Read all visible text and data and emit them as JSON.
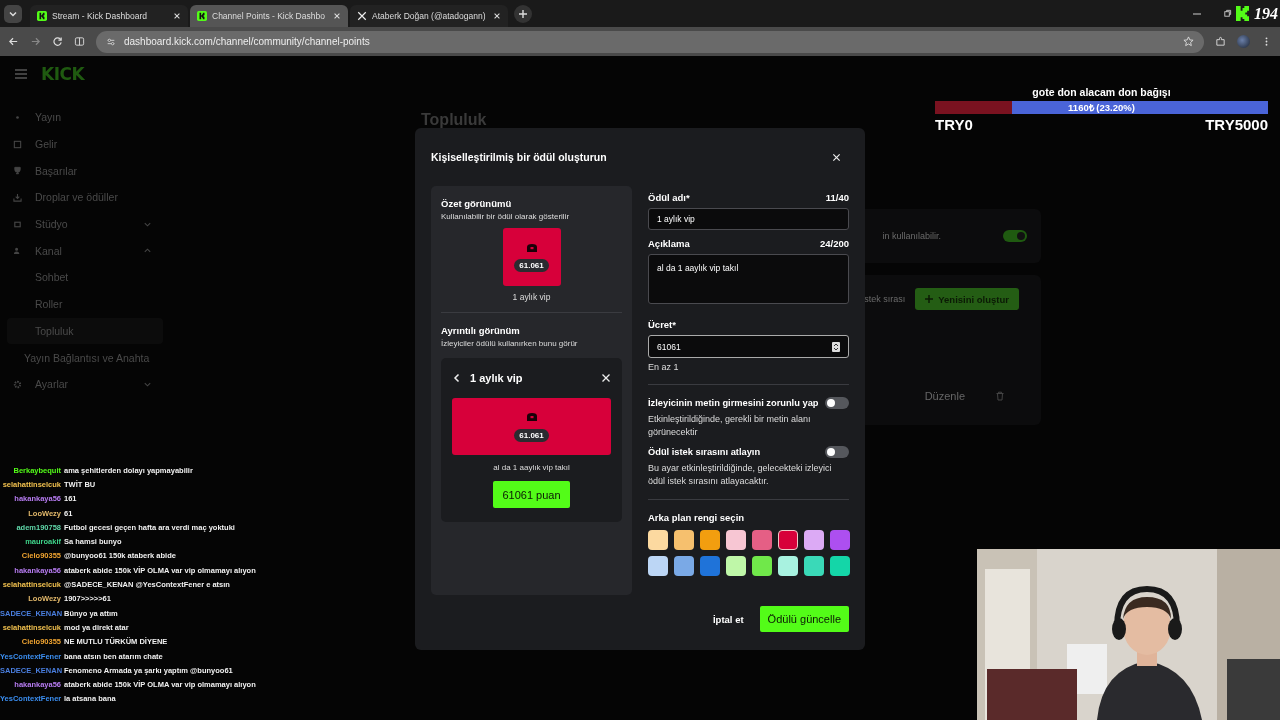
{
  "browser": {
    "tabs": [
      {
        "title": "Stream - Kick Dashboard",
        "selected": false,
        "kind": "kick"
      },
      {
        "title": "Channel Points - Kick Dashbo",
        "selected": true,
        "kind": "kick"
      },
      {
        "title": "Ataberk Doğan (@atadogann)",
        "selected": false,
        "kind": "x"
      }
    ],
    "url": "dashboard.kick.com/channel/community/channel-points",
    "viewer_count": "194"
  },
  "sidebar": {
    "logo": "KICK",
    "items": [
      {
        "label": "Yayın",
        "selected": false
      },
      {
        "label": "Gelir",
        "selected": false
      },
      {
        "label": "Başarılar",
        "selected": false
      },
      {
        "label": "Droplar ve ödüller",
        "selected": false
      },
      {
        "label": "Stüdyo",
        "selected": false,
        "expanded": false
      },
      {
        "label": "Kanal",
        "selected": false,
        "expanded": true,
        "children": [
          {
            "label": "Sohbet",
            "selected": false
          },
          {
            "label": "Roller",
            "selected": false
          },
          {
            "label": "Topluluk",
            "selected": true
          }
        ]
      },
      {
        "label": "Yayın Bağlantısı ve Anahta",
        "selected": false,
        "kind": "plain"
      },
      {
        "label": "Ayarlar",
        "selected": false,
        "expanded": false
      }
    ]
  },
  "page": {
    "heading": "Topluluk",
    "setting_text": "in kullanılabilir.",
    "setting_on": true,
    "queue_text": "stek sırası",
    "new_button": "Yenisini oluştur",
    "edit_link": "Düzenle"
  },
  "modal": {
    "title": "Kişiselleştirilmiş bir ödül oluşturun",
    "summary": {
      "title": "Özet görünümü",
      "subtitle": "Kullanılabilir bir ödül olarak gösterilir",
      "badge": "61.061",
      "name": "1 aylık vip"
    },
    "detail": {
      "title": "Ayrıntılı görünüm",
      "subtitle": "İzleyiciler ödülü kullanırken bunu görür",
      "header": "1 aylık vip",
      "badge": "61.061",
      "description": "al da 1 aaylık vip takıl",
      "button": "61061 puan"
    },
    "name_field": {
      "label": "Ödül adı*",
      "count": "11/40",
      "value": "1 aylık vip"
    },
    "description_field": {
      "label": "Açıklama",
      "count": "24/200",
      "value": "al da 1 aaylık vip takıl"
    },
    "cost_field": {
      "label": "Ücret*",
      "value": "61061",
      "hint": "En az 1"
    },
    "toggles": [
      {
        "label": "İzleyicinin metin girmesini zorunlu yap",
        "description": "Etkinleştirildiğinde, gerekli bir metin alanı görünecektir",
        "on": false
      },
      {
        "label": "Ödül istek sırasını atlayın",
        "description": "Bu ayar etkinleştirildiğinde, gelecekteki izleyici ödül istek sırasını atlayacaktır.",
        "on": false
      }
    ],
    "color_label": "Arka plan rengi seçin",
    "colors": [
      {
        "color": "#fcd9a0",
        "selected": false
      },
      {
        "color": "#f6c06e",
        "selected": false
      },
      {
        "color": "#f29e0f",
        "selected": false
      },
      {
        "color": "#f7c6d3",
        "selected": false
      },
      {
        "color": "#e55f85",
        "selected": false
      },
      {
        "color": "#d7003a",
        "selected": true
      },
      {
        "color": "#dcaaf5",
        "selected": false
      },
      {
        "color": "#ad4ff0",
        "selected": false
      },
      {
        "color": "#bcd6f5",
        "selected": false
      },
      {
        "color": "#7aa9e6",
        "selected": false
      },
      {
        "color": "#1f73d9",
        "selected": false
      },
      {
        "color": "#bff7a8",
        "selected": false
      },
      {
        "color": "#70e84a",
        "selected": false
      },
      {
        "color": "#a8f2e0",
        "selected": false
      },
      {
        "color": "#3ad9b8",
        "selected": false
      },
      {
        "color": "#14d6a8",
        "selected": false
      }
    ],
    "cancel": "İptal et",
    "submit": "Ödülü güncelle"
  },
  "donation_goal": {
    "title": "gote don alacam don bağışı",
    "amount": "1160₺ (23.20%)",
    "level": 0.232,
    "min": "TRY0",
    "max": "TRY5000"
  },
  "chat": [
    {
      "user": "Berkaybequit",
      "color": "#53fc18",
      "text": "ama şehitlerden dolayı yapmayabilir"
    },
    {
      "user": "selahattinselcuk",
      "color": "#f2c14e",
      "text": "TWİT BU"
    },
    {
      "user": "hakankaya56",
      "color": "#b77cf2",
      "text": "161"
    },
    {
      "user": "LooWezy",
      "color": "#e3b96b",
      "text": "61"
    },
    {
      "user": "adem190758",
      "color": "#5fd6a8",
      "text": "Futbol gecesi geçen hafta ara verdi maç yoktuki"
    },
    {
      "user": "mauroakif",
      "color": "#3fd48a",
      "text": "Sa hamsi bunyo"
    },
    {
      "user": "Cielo90355",
      "color": "#f0a431",
      "text": "@bunyoo61 150k ataberk abide"
    },
    {
      "user": "hakankaya56",
      "color": "#b77cf2",
      "text": "ataberk abide 150k VİP OLMA var vip olmamayı alıyon"
    },
    {
      "user": "selahattinselcuk",
      "color": "#f2c14e",
      "text": "@SADECE_KENAN @YesContextFener e atsın"
    },
    {
      "user": "LooWezy",
      "color": "#e3b96b",
      "text": "1907>>>>>61"
    },
    {
      "user": "SADECE_KENAN",
      "color": "#4a7fe0",
      "text": "Bünyo ya attım"
    },
    {
      "user": "selahattinselcuk",
      "color": "#f2c14e",
      "text": "mod ya direkt atar"
    },
    {
      "user": "Cielo90355",
      "color": "#f0a431",
      "text": "NE MUTLU TÜRKÜM DİYENE"
    },
    {
      "user": "YesContextFener",
      "color": "#3b8ef0",
      "text": "bana atsın ben atarım chate"
    },
    {
      "user": "SADECE_KENAN",
      "color": "#4a7fe0",
      "text": "Fenomeno Armada ya şarkı yaptım @bunyoo61"
    },
    {
      "user": "hakankaya56",
      "color": "#b77cf2",
      "text": "ataberk abide 150k VİP OLMA var vip olmamayı alıyon"
    },
    {
      "user": "YesContextFener",
      "color": "#3b8ef0",
      "text": "la atsana bana"
    }
  ]
}
